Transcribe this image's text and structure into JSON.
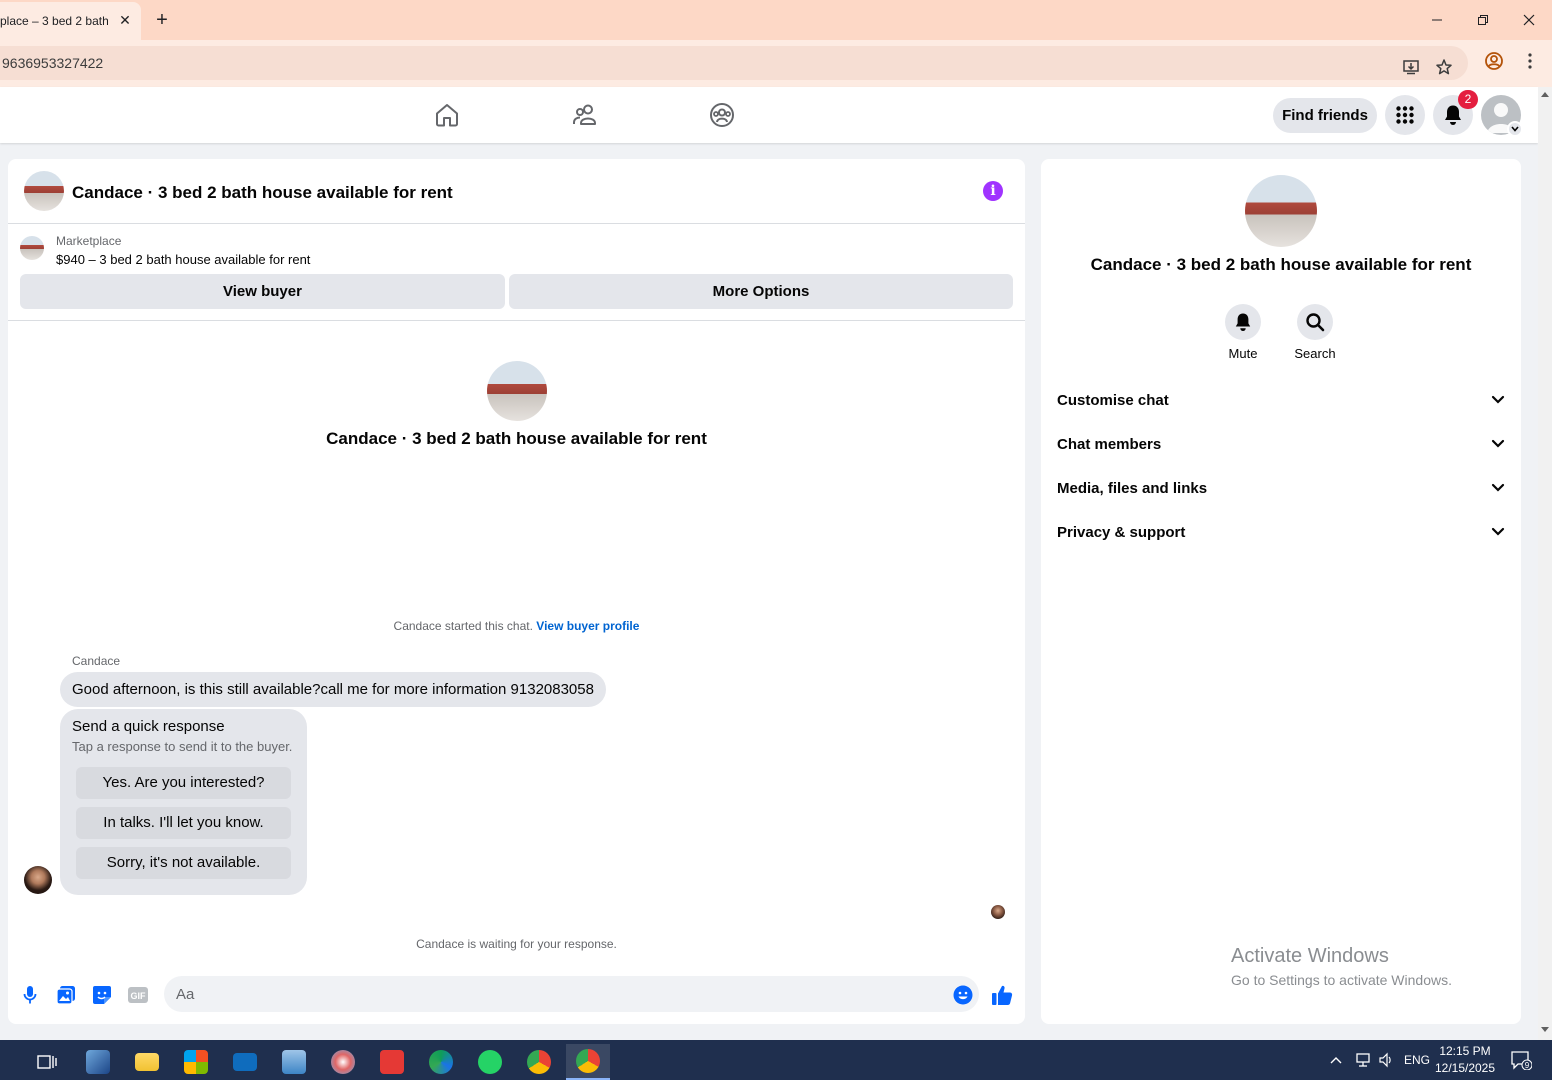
{
  "browser": {
    "tab_title": "place – 3 bed 2 bath",
    "tab_close": "✕",
    "new_tab": "+",
    "url": "9636953327422"
  },
  "nav": {
    "find_friends": "Find friends",
    "notification_count": "2"
  },
  "chat": {
    "title": "Candace · 3 bed 2 bath house available for rent",
    "marketplace_label": "Marketplace",
    "listing": "$940 – 3 bed 2 bath house available for rent",
    "view_buyer": "View buyer",
    "more_options": "More Options",
    "center_name": "Candace · 3 bed 2 bath house available for rent",
    "started_text": "Candace started this chat.",
    "view_buyer_profile": "View buyer profile",
    "sender": "Candace",
    "message": "Good afternoon, is this still available?call me for more information 9132083058",
    "quick_title": "Send a quick response",
    "quick_sub": "Tap a response to send it to the buyer.",
    "quick_replies": [
      "Yes. Are you interested?",
      "In talks. I'll let you know.",
      "Sorry, it's not available."
    ],
    "waiting": "Candace is waiting for your response.",
    "composer_placeholder": "Aa",
    "gif": "GIF"
  },
  "side": {
    "name": "Candace · 3 bed 2 bath house available for rent",
    "mute": "Mute",
    "search": "Search",
    "sections": [
      "Customise chat",
      "Chat members",
      "Media, files and links",
      "Privacy & support"
    ]
  },
  "watermark": {
    "line1": "Activate Windows",
    "line2": "Go to Settings to activate Windows."
  },
  "taskbar": {
    "lang": "ENG",
    "time": "12:15 PM",
    "date": "12/15/2025",
    "notif_count": "9"
  },
  "colors": {
    "accent": "#0866ff",
    "info": "#a033ff",
    "badge": "#e41e3f",
    "tabbar": "#fdd8c6"
  }
}
